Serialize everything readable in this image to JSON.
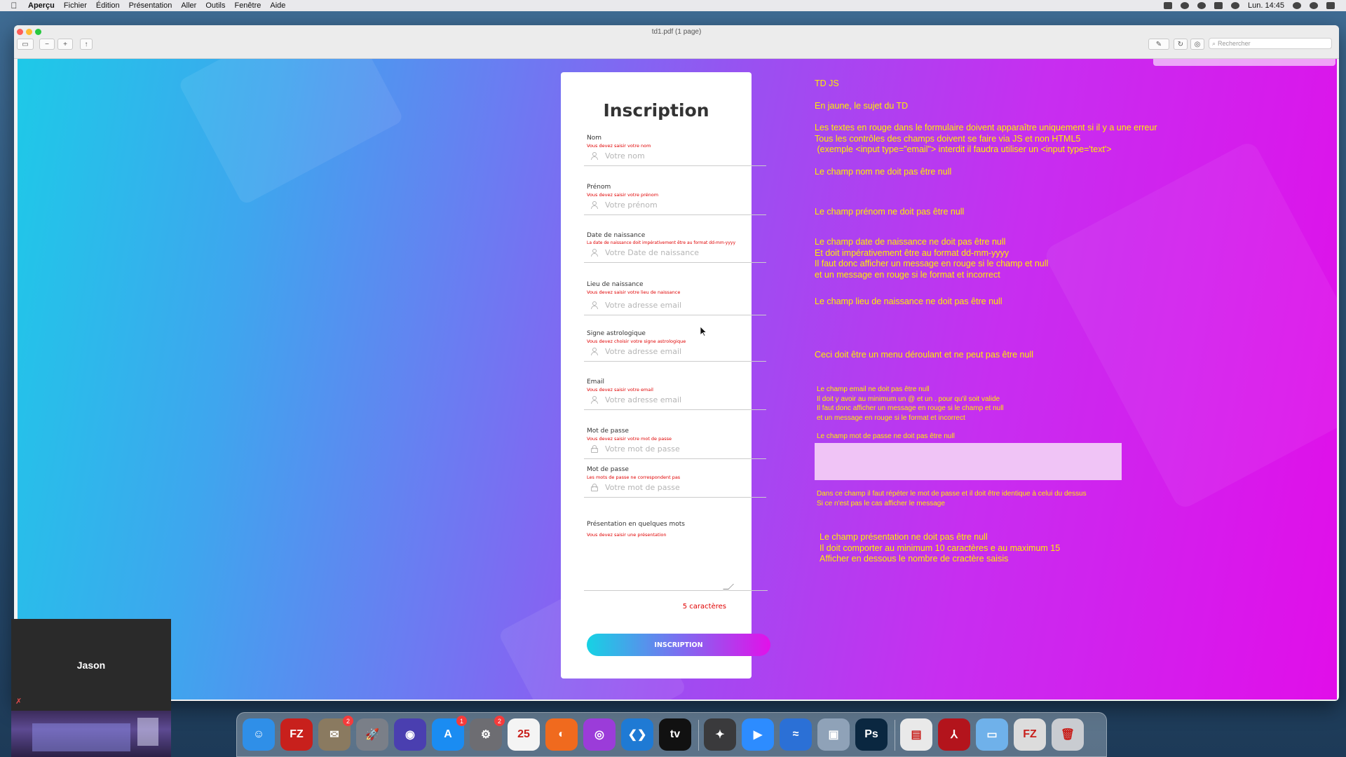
{
  "menubar": {
    "apple_icon": "apple-icon",
    "app_name": "Aperçu",
    "items": [
      "Fichier",
      "Édition",
      "Présentation",
      "Aller",
      "Outils",
      "Fenêtre",
      "Aide"
    ],
    "clock": "Lun. 14:45"
  },
  "window": {
    "title": "td1.pdf (1 page)",
    "search_placeholder": "Rechercher"
  },
  "form": {
    "title": "Inscription",
    "fields": [
      {
        "label": "Nom",
        "error": "Vous devez saisir votre nom",
        "placeholder": "Votre nom",
        "icon": "user-icon"
      },
      {
        "label": "Prénom",
        "error": "Vous devez saisir votre prénom",
        "placeholder": "Votre prénom",
        "icon": "user-icon"
      },
      {
        "label": "Date de naissance",
        "error": "La date de naissance doit impérativement être au format dd-mm-yyyy",
        "placeholder": "Votre Date de naissance",
        "icon": "user-icon"
      },
      {
        "label": "Lieu de naissance",
        "error": "Vous devez saisir votre lieu de naissance",
        "placeholder": "Votre adresse email",
        "icon": "user-icon"
      },
      {
        "label": "Signe astrologique",
        "error": "Vous devez choisir votre signe astrologique",
        "placeholder": "Votre adresse email",
        "icon": "user-icon"
      },
      {
        "label": "Email",
        "error": "Vous devez saisir votre email",
        "placeholder": "Votre adresse email",
        "icon": "user-icon"
      },
      {
        "label": "Mot de passe",
        "error": "Vous devez saisir votre mot de passe",
        "placeholder": "Votre mot de passe",
        "icon": "lock-icon"
      },
      {
        "label": "Mot de passe",
        "error": "Les mots de passe ne correspondent pas",
        "placeholder": "Votre mot de passe",
        "icon": "lock-icon"
      }
    ],
    "presentation": {
      "label": "Présentation en quelques mots",
      "error": "Vous devez saisir une présentation"
    },
    "char_count": "5 caractères",
    "submit_label": "INSCRIPTION"
  },
  "notes": {
    "title": "TD JS",
    "subtitle": "En jaune, le sujet du TD",
    "intro": "Les textes en rouge dans le formulaire doivent apparaître uniquement si il y a une erreur\nTous les contrôles des champs doivent se faire via JS et non HTML5\n (exemple <input type=\"email\"> interdit il faudra utiliser un <input type='text'>",
    "nom": "Le champ nom ne doit pas être null",
    "prenom": "Le champ prénom ne doit pas être null",
    "date": "Le champ date de naissance ne doit pas être null\nEt doit impérativement être au format dd-mm-yyyy\nIl faut donc afficher un message en rouge si le champ et null\net un message en rouge si le format et incorrect",
    "lieu": "Le champ lieu de naissance ne doit pas être null",
    "signe": "Ceci doit être un menu déroulant et ne peut pas être null",
    "email": "Le champ email ne doit pas être null\nIl doit y avoir au minimum un @ et un . pour qu'il soit valide\nIl faut donc afficher un message en rouge si le champ et null\net un message en rouge si le format et incorrect",
    "password": "Le champ mot de passe ne doit pas être null",
    "confirm": "Dans ce champ il faut répéter le mot de passe et il doit être identique à celui du dessus\nSi ce n'est pas le cas afficher le message",
    "presentation": "Le champ présentation ne doit pas être null\nIl doit comporter au minimum 10 caractères e au maximum 15\nAfficher en dessous le nombre de cractère saisis"
  },
  "video_tile": {
    "name": "Jason",
    "mic_icon": "muted-mic-icon"
  },
  "dock": {
    "apps": [
      {
        "name": "finder-icon",
        "glyph": "☺",
        "color": "#2f8fe8",
        "badge": ""
      },
      {
        "name": "filezilla-icon",
        "glyph": "FZ",
        "color": "#c8201c",
        "badge": ""
      },
      {
        "name": "mail-stamp-icon",
        "glyph": "✉",
        "color": "#8a7a60",
        "badge": "2"
      },
      {
        "name": "launchpad-icon",
        "glyph": "🚀",
        "color": "#7a7f88",
        "badge": ""
      },
      {
        "name": "siri-icon",
        "glyph": "◉",
        "color": "#4a3fb0",
        "badge": ""
      },
      {
        "name": "app-store-icon",
        "glyph": "A",
        "color": "#1a8cf2",
        "badge": "1"
      },
      {
        "name": "system-preferences-icon",
        "glyph": "⚙",
        "color": "#6d6d72",
        "badge": "2"
      },
      {
        "name": "calendar-icon",
        "glyph": "25",
        "color": "#f4f4f4",
        "badge": ""
      },
      {
        "name": "firefox-icon",
        "glyph": "◐",
        "color": "#f06a1e",
        "badge": ""
      },
      {
        "name": "podcasts-icon",
        "glyph": "◎",
        "color": "#9b3cd9",
        "badge": ""
      },
      {
        "name": "vscode-icon",
        "glyph": "❮❯",
        "color": "#1f7ad4",
        "badge": ""
      },
      {
        "name": "apple-tv-icon",
        "glyph": "tv",
        "color": "#111111",
        "badge": ""
      },
      {
        "name": "safari-icon",
        "glyph": "✦",
        "color": "#3a3a3c",
        "badge": ""
      },
      {
        "name": "zoom-icon",
        "glyph": "▶",
        "color": "#2d8cff",
        "badge": ""
      },
      {
        "name": "migration-assistant-icon",
        "glyph": "≈",
        "color": "#2b70d6",
        "badge": ""
      },
      {
        "name": "preview-icon",
        "glyph": "▣",
        "color": "#8fa2b8",
        "badge": ""
      },
      {
        "name": "photoshop-icon",
        "glyph": "Ps",
        "color": "#0a2740",
        "badge": ""
      },
      {
        "name": "document-docx-icon",
        "glyph": "▤",
        "color": "#e9e9e9",
        "badge": ""
      },
      {
        "name": "acrobat-icon",
        "glyph": "⅄",
        "color": "#b3141c",
        "badge": ""
      },
      {
        "name": "folder-icon",
        "glyph": "▭",
        "color": "#6fb1ea",
        "badge": ""
      },
      {
        "name": "filezilla-doc-icon",
        "glyph": "FZ",
        "color": "#dcdcdc",
        "badge": ""
      },
      {
        "name": "trash-icon",
        "glyph": "🗑",
        "color": "#c9ccd1",
        "badge": ""
      }
    ]
  }
}
